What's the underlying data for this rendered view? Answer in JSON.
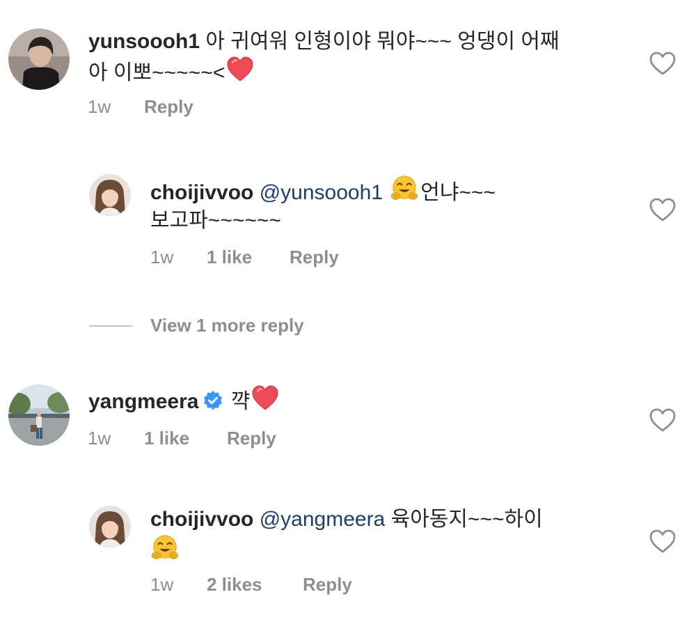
{
  "comments": [
    {
      "username": "yunsoooh1",
      "mention": "",
      "text_line1": "아 귀여워 인형이야 뭐야~~~ 엉댕이 어째",
      "text_line2": "아 이뽀~~~~~<",
      "emoji_end": "heart",
      "time": "1w",
      "likes": "",
      "reply_label": "Reply"
    },
    {
      "username": "choijivvoo",
      "mention": "@yunsoooh1",
      "text_line1_after_emoji": "언냐~~~",
      "text_line2": "보고파~~~~~~",
      "emoji_inline": "hugging-face",
      "time": "1w",
      "likes": "1 like",
      "reply_label": "Reply"
    },
    {
      "username": "yangmeera",
      "verified": true,
      "text": "꺅",
      "emoji_end": "heart",
      "time": "1w",
      "likes": "1 like",
      "reply_label": "Reply"
    },
    {
      "username": "choijivvoo",
      "mention": "@yangmeera",
      "text_line1": "육아동지~~~하이",
      "emoji_line2": "hugging-face",
      "time": "1w",
      "likes": "2 likes",
      "reply_label": "Reply"
    }
  ],
  "view_more_replies": "View 1 more reply",
  "colors": {
    "text": "#262626",
    "meta": "#8e8e8e",
    "mention": "#1f3d6b",
    "verified": "#3897f0",
    "heart": "#ed4956"
  }
}
